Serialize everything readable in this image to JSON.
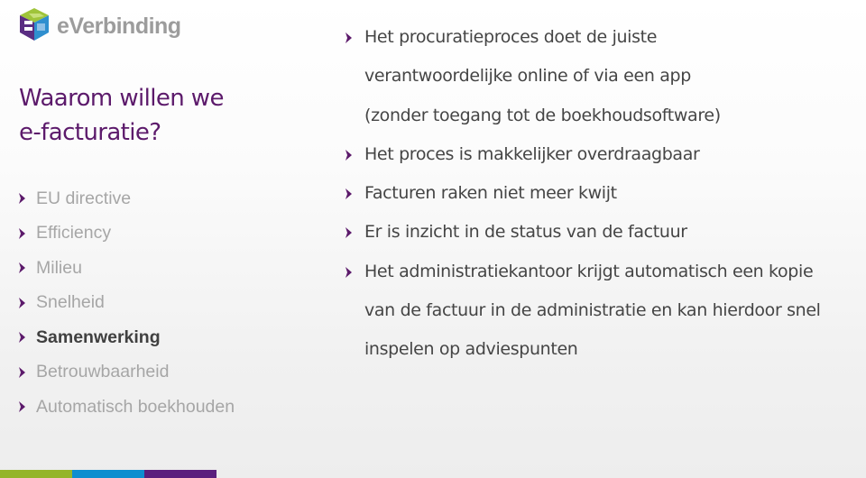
{
  "brand": {
    "name": "eVerbinding",
    "logo_icon": "cube-logo-icon"
  },
  "colors": {
    "title": "#5c1a6b",
    "bullet": "#5c1a6b",
    "nav_inactive": "#a6a6a6",
    "nav_active": "#404040",
    "body_text": "#454545",
    "bar_green": "#94b52a",
    "bar_blue": "#0d8ecf",
    "bar_purple": "#5a1f7d"
  },
  "slide": {
    "title_line1": "Waarom willen we",
    "title_line2": "e-facturatie?"
  },
  "nav": {
    "bullet_icon": "purple-arrow-bullet-icon",
    "items": [
      {
        "label": "EU directive",
        "active": false
      },
      {
        "label": "Efficiency",
        "active": false
      },
      {
        "label": "Milieu",
        "active": false
      },
      {
        "label": "Snelheid",
        "active": false
      },
      {
        "label": "Samenwerking",
        "active": true
      },
      {
        "label": "Betrouwbaarheid",
        "active": false
      },
      {
        "label": "Automatisch boekhouden",
        "active": false
      }
    ]
  },
  "content": {
    "bullets": [
      {
        "text": "Het procuratieproces doet de juiste verantwoordelijke online of via een app (zonder toegang tot de boekhoudsoftware)"
      },
      {
        "text": "Het proces is makkelijker overdraagbaar"
      },
      {
        "text": "Facturen raken niet meer kwijt"
      },
      {
        "text": "Er is inzicht in de status van de factuur"
      },
      {
        "text": "Het administratiekantoor krijgt automatisch een kopie van de factuur in de administratie en kan hierdoor snel inspelen op adviespunten"
      }
    ]
  }
}
